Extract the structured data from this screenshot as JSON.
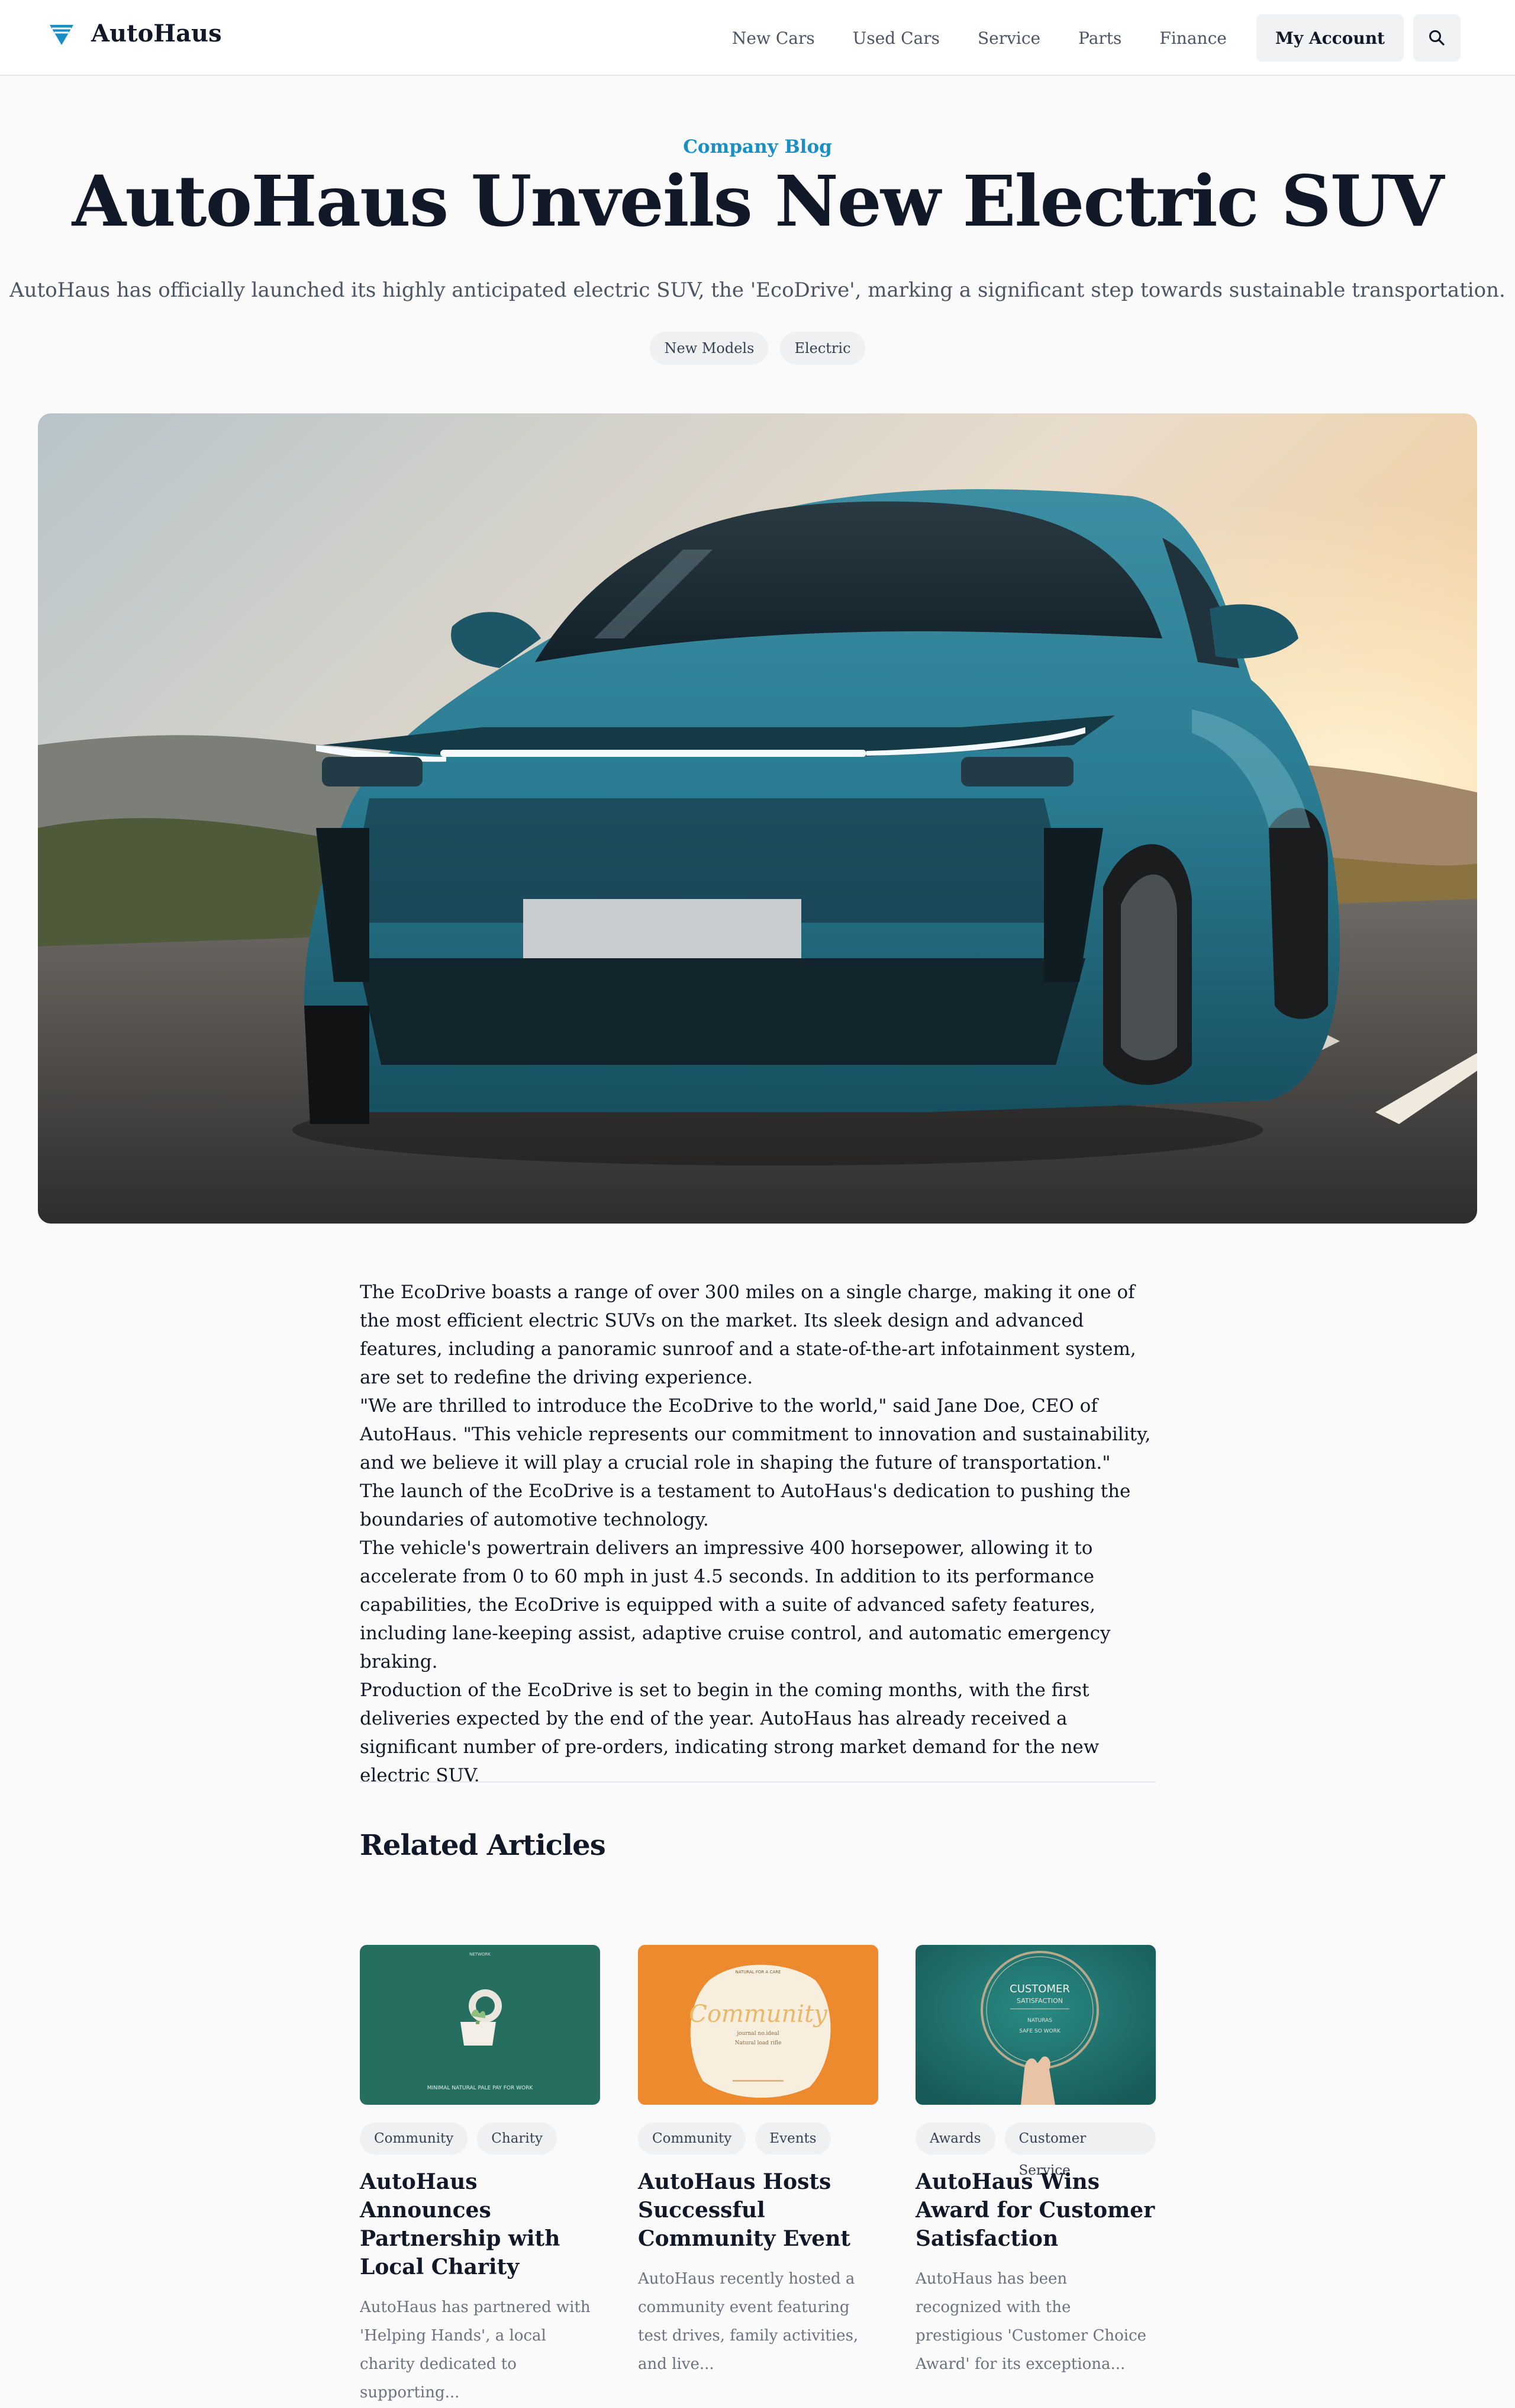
{
  "nav": {
    "brand": "AutoHaus",
    "links": [
      "New Cars",
      "Used Cars",
      "Service",
      "Parts",
      "Finance"
    ],
    "account_label": "My Account",
    "search_icon": "search-icon",
    "logo_icon": "autohaus-logo-icon",
    "accent_color": "#1a8fc4"
  },
  "header": {
    "eyebrow": "Company Blog",
    "title": "AutoHaus Unveils New Electric SUV",
    "subtitle": "AutoHaus has officially launched its highly anticipated electric SUV, the 'EcoDrive', marking a significant step towards sustainable transportation.",
    "tags": [
      "New Models",
      "Electric"
    ]
  },
  "article": {
    "paragraphs": [
      "The EcoDrive boasts a range of over 300 miles on a single charge, making it one of the most efficient electric SUVs on the market. Its sleek design and advanced features, including a panoramic sunroof and a state-of-the-art infotainment system, are set to redefine the driving experience.",
      "\"We are thrilled to introduce the EcoDrive to the world,\" said Jane Doe, CEO of AutoHaus. \"This vehicle represents our commitment to innovation and sustainability, and we believe it will play a crucial role in shaping the future of transportation.\"",
      "The launch of the EcoDrive is a testament to AutoHaus's dedication to pushing the boundaries of automotive technology.",
      "The vehicle's powertrain delivers an impressive 400 horsepower, allowing it to accelerate from 0 to 60 mph in just 4.5 seconds. In addition to its performance capabilities, the EcoDrive is equipped with a suite of advanced safety features, including lane-keeping assist, adaptive cruise control, and automatic emergency braking.",
      "Production of the EcoDrive is set to begin in the coming months, with the first deliveries expected by the end of the year. AutoHaus has already received a significant number of pre-orders, indicating strong market demand for the new electric SUV."
    ]
  },
  "related": {
    "title": "Related Articles",
    "cards": [
      {
        "tags": [
          "Community",
          "Charity"
        ],
        "title": "AutoHaus Announces Partnership with Local Charity",
        "excerpt": "AutoHaus has partnered with 'Helping Hands', a local charity dedicated to supporting...",
        "image_caption": "MINIMAL NATURAL PALE PAY FOR WORK",
        "image_top": "NETWORK"
      },
      {
        "tags": [
          "Community",
          "Events"
        ],
        "title": "AutoHaus Hosts Successful Community Event",
        "excerpt": "AutoHaus recently hosted a community event featuring test drives, family activities, and live...",
        "image_script": "Community",
        "image_top": "NATURAL FOR A CARE",
        "image_line1": "journal no.ideal",
        "image_line2": "Natural load rifle"
      },
      {
        "tags": [
          "Awards",
          "Customer Service"
        ],
        "title": "AutoHaus Wins Award for Customer Satisfaction",
        "excerpt": "AutoHaus has been recognized with the prestigious 'Customer Choice Award' for its exceptiona...",
        "image_line1": "CUSTOMER",
        "image_line2": "SATISFACTION",
        "image_line3": "NATURAS",
        "image_line4": "SAFE SO WORK"
      }
    ]
  }
}
